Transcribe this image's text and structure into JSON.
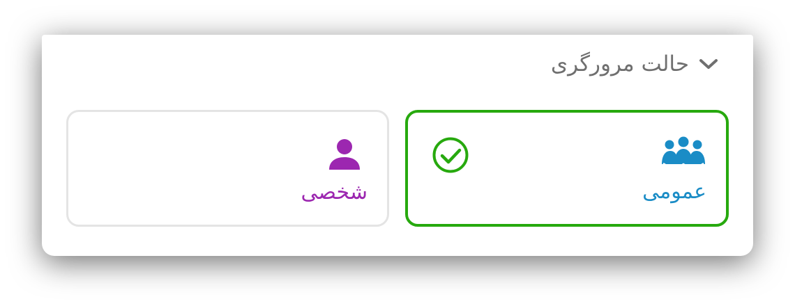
{
  "browsing_mode": {
    "title": "حالت مرورگری",
    "expand_icon": "chevron-down-icon",
    "options": [
      {
        "id": "public",
        "label": "عمومی",
        "icon": "users-group-icon",
        "selected": true,
        "color": "#1a8cc6"
      },
      {
        "id": "personal",
        "label": "شخصی",
        "icon": "user-icon",
        "selected": false,
        "color": "#9c27b0"
      }
    ],
    "selected_indicator_icon": "check-circle-icon",
    "colors": {
      "selected_border": "#27a90e",
      "unselected_border": "#e4e4e4",
      "title": "#6f6f6f"
    }
  }
}
